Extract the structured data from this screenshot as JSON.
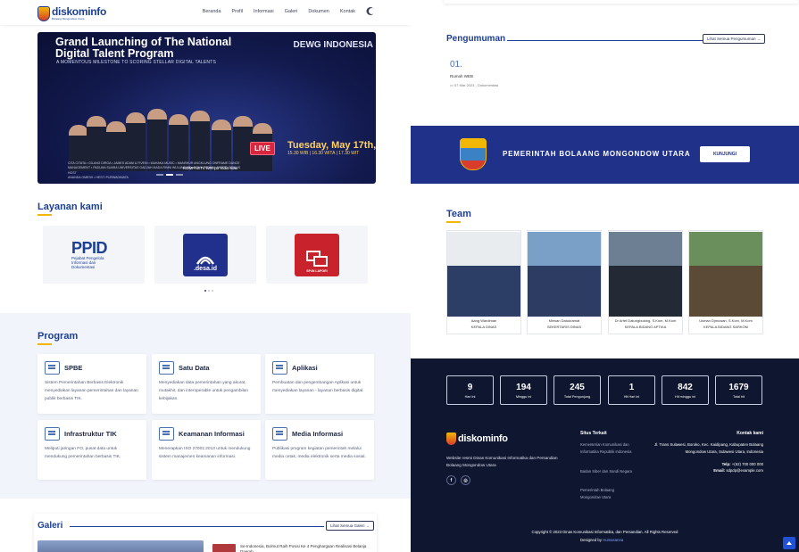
{
  "nav": {
    "logo_text": "diskominfo",
    "logo_tagline": "Bolaang Mongondow Utara",
    "items": [
      "Beranda",
      "Profil",
      "Informasi",
      "Galeri",
      "Dokumen",
      "Kontak"
    ]
  },
  "hero": {
    "title": "Grand Launching of The National Digital Talent Program",
    "subtitle": "A MOMENTOUS MILESTONE TO SCORING STELLAR DIGITAL TALENTS",
    "event_logo": "DEWG INDONESIA",
    "performers": "CITA CITATA • GILANG DIRGA • JAMES ADAM & FIVEIN • MAHAKA MUSIC • MANSHUR ANGKLUNG ONFRAME DANCE MANAGEMENT • PADUAN SUARA UNIVERSITAS GADJAH MADA RINNI WULANDARI • ROKY FEBIAN • WERO GENIUS",
    "host_label": "HOST",
    "hosts": "ANANDA OMESH • HESTI PURWADINATA",
    "live_label": "LIVE",
    "date": "Tuesday, May 17th, 20",
    "times": "15.30 WIB | 16.30 WITA | 17.30 WIT",
    "sponsors": "KOMPASTV   tvRI   pb   Vidio   max",
    "slide_count": 3,
    "active_slide": 1
  },
  "layanan": {
    "title": "Layanan kami",
    "cards": [
      {
        "name": "PPID",
        "subtitle": "Pejabat Pengelola Informasi dan Dokumentasi"
      },
      {
        "name": ".desa.id"
      },
      {
        "name": "SP4N LAPOR!"
      }
    ],
    "dots": 3
  },
  "program": {
    "title": "Program",
    "items": [
      {
        "name": "SPBE",
        "desc": "Sistem Pemerintahan Berbasis Elektronik menyediakan layanan pemerintahan dan layanan publik berbasis TIK."
      },
      {
        "name": "Satu Data",
        "desc": "Menyediakan data pemerintahan yang akurat, mutakhir, dan interoperable untuk pengambilan kebijakan."
      },
      {
        "name": "Aplikasi",
        "desc": "Pembuatan dan pengembangan Aplikasi untuk menyediakan layanan - layanan berbasis digital."
      },
      {
        "name": "Infrastruktur TIK",
        "desc": "Meliputi jaringan FO, pusat data untuk mendukung pemerintahan berbasis TIK."
      },
      {
        "name": "Keamanan Informasi",
        "desc": "Menerapkan ISO 27001:2013 untuk mendukung sistem manajemen keamanan informasi."
      },
      {
        "name": "Media Informasi",
        "desc": "Publikasi program kegiatan pemerintah melalui media cetak, media elektronik serta media sosial."
      }
    ]
  },
  "galeri": {
    "title": "Galeri",
    "button": "Lihat Semua Galeri →",
    "caption": "Se-Indonesia, Bolmut Raih Posisi Ke 4 Penghargaan Realisasi Belanja Daerah"
  },
  "pengumuman": {
    "title": "Pengumuman",
    "button": "Lihat Semua Pengumuman →",
    "items": [
      {
        "num": "01.",
        "title": "Rumah WEB",
        "meta": "07 Mar 2023 - Dokumentasi"
      }
    ]
  },
  "banner": {
    "title": "PEMERINTAH BOLAANG MONGONDOW UTARA",
    "button": "KUNJUNGI"
  },
  "team": {
    "title": "Team",
    "members": [
      {
        "name": "Aang Wardiman",
        "role": "KEPALA DINAS"
      },
      {
        "name": "Mirwan Datukramat",
        "role": "SEKERTARIS DINAS"
      },
      {
        "name": "Dr Arfet Datungbolang, S.Kom, M.Kom",
        "role": "KEPALA BIDANG APTIKA"
      },
      {
        "name": "Usman Djmuwan, S.Kom, M.Kom",
        "role": "KEPALA BIDANG SARKOM"
      }
    ]
  },
  "stats": [
    {
      "value": "9",
      "label": "Hari ini"
    },
    {
      "value": "194",
      "label": "Minggu ini"
    },
    {
      "value": "245",
      "label": "Total Pengunjung"
    },
    {
      "value": "1",
      "label": "Hit Hari ini"
    },
    {
      "value": "842",
      "label": "Hit minggu ini"
    },
    {
      "value": "1679",
      "label": "Total hit"
    }
  ],
  "footer": {
    "logo_text": "diskominfo",
    "about": "Website resmi Dinas Komunikasi Informatika dan Persandian Bolaang Mongondow Utara",
    "situs_title": "Situs Terkait",
    "links": [
      "Kementerian Komunikasi dan Informatika Republik Indonesia",
      "Badan Siber dan Sandi Negara",
      "Pemerintah Bolaang Mongondow Utara"
    ],
    "kontak_title": "Kontak kami",
    "address": "Jl. Trans Sulawesi, Boroko, Kec. Kaidipang, Kabupaten Bolaang Mongondow Utara, Sulawesi Utara, Indonesia",
    "telp_label": "Telp:",
    "telp": "+(62) 700 000 000",
    "email_label": "Email:",
    "email": "sdpdp@example.com",
    "copyright": "Copyright © 2023 Dinas Komunikasi Informatika, dan Persandian. All Rights Reserved",
    "designed_label": "Designed by",
    "designer": "Humasanna"
  }
}
